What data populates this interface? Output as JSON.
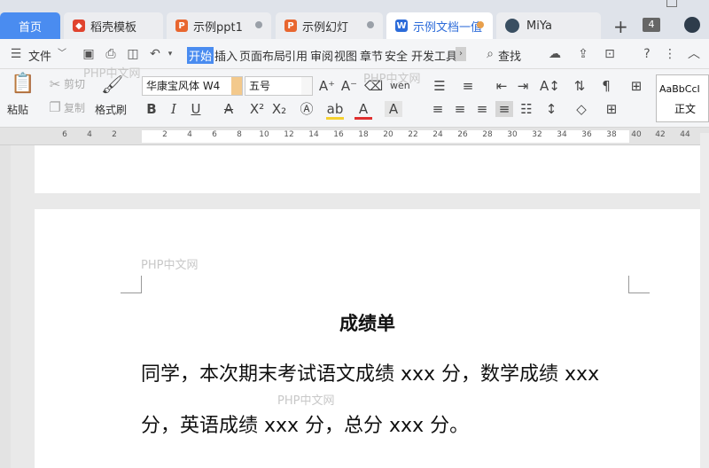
{
  "tabs": {
    "home": "首页",
    "templates": "稻壳模板",
    "ppt1": "示例ppt1",
    "slides": "示例幻灯",
    "doc": "示例文档一值",
    "user": "MiYa",
    "plus": "+",
    "count": "4"
  },
  "menu": {
    "file": "文件",
    "items": [
      "开始",
      "插入",
      "页面布局",
      "引用",
      "审阅",
      "视图",
      "章节",
      "安全",
      "开发工具"
    ],
    "search": "查找"
  },
  "ribbon": {
    "paste": "粘贴",
    "cut": "剪切",
    "copy": "复制",
    "format_painter": "格式刷",
    "font_name": "华康宝风体 W4",
    "font_size": "五号",
    "style_sample": "AaBbCcI",
    "style_name": "正文"
  },
  "ruler": {
    "left_numbers": [
      "6",
      "4",
      "2"
    ],
    "numbers": [
      "2",
      "4",
      "6",
      "8",
      "10",
      "12",
      "14",
      "16",
      "18",
      "20",
      "22",
      "24",
      "26",
      "28",
      "30",
      "32",
      "34",
      "36",
      "38",
      "40"
    ],
    "right_numbers": [
      "42",
      "44"
    ]
  },
  "document": {
    "title": "成绩单",
    "line1": "同学，本次期末考试语文成绩 xxx 分，数学成绩 xxx",
    "line2": "分，英语成绩 xxx 分，总分 xxx 分。"
  },
  "watermark": "PHP中文网",
  "colors": {
    "accent": "#4a8cf0",
    "tab_bar": "#dfe3ea",
    "ribbon": "#f4f5f7",
    "page": "#ffffff"
  }
}
